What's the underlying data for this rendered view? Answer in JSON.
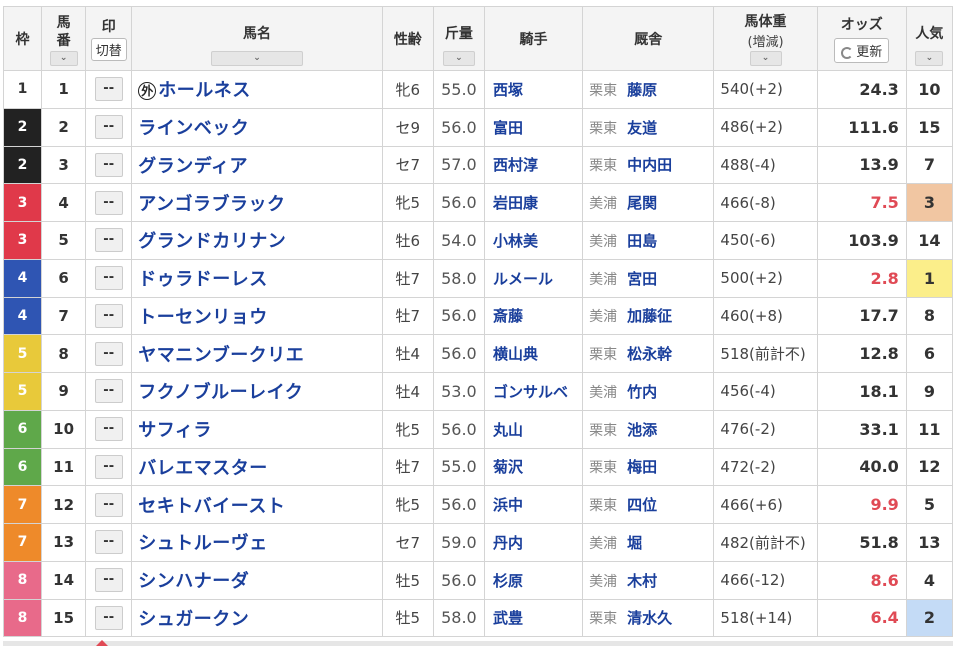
{
  "header": {
    "waku": "枠",
    "umaban": "馬\n番",
    "umaban_1": "馬",
    "umaban_2": "番",
    "shirushi": "印",
    "kirikae": "切替",
    "bamei": "馬名",
    "seirei": "性齢",
    "kinryo": "斤量",
    "kishu": "騎手",
    "kyusha": "厩舎",
    "bataiju": "馬体重",
    "zogen": "(増減)",
    "odds": "オッズ",
    "koshin": "更新",
    "ninki": "人気",
    "sort_icon": "chevron-down-icon",
    "sort_glyph": "⌄"
  },
  "colors": {
    "waku": {
      "1": "#ffffff",
      "2": "#222222",
      "3": "#e0394a",
      "4": "#2f55b3",
      "5": "#e8c93a",
      "6": "#5fa84a",
      "7": "#ee8a2a",
      "8": "#e86a8a"
    },
    "link": "#1a3f9c",
    "hot_odds": "#e04a55"
  },
  "mark_label": "--",
  "foreign_badge": "外",
  "rows": [
    {
      "waku": "1",
      "umaban": "1",
      "name": "ホールネス",
      "foreign": true,
      "sexage": "牝6",
      "weight": "55.0",
      "jockey": "西塚",
      "area": "栗東",
      "trainer": "藤原",
      "bw": "540(+2)",
      "odds": "24.3",
      "hot": false,
      "pop": "10",
      "popcls": ""
    },
    {
      "waku": "2",
      "umaban": "2",
      "name": "ラインベック",
      "foreign": false,
      "sexage": "セ9",
      "weight": "56.0",
      "jockey": "富田",
      "area": "栗東",
      "trainer": "友道",
      "bw": "486(+2)",
      "odds": "111.6",
      "hot": false,
      "pop": "15",
      "popcls": ""
    },
    {
      "waku": "2",
      "umaban": "3",
      "name": "グランディア",
      "foreign": false,
      "sexage": "セ7",
      "weight": "57.0",
      "jockey": "西村淳",
      "area": "栗東",
      "trainer": "中内田",
      "bw": "488(-4)",
      "odds": "13.9",
      "hot": false,
      "pop": "7",
      "popcls": ""
    },
    {
      "waku": "3",
      "umaban": "4",
      "name": "アンゴラブラック",
      "foreign": false,
      "sexage": "牝5",
      "weight": "56.0",
      "jockey": "岩田康",
      "area": "美浦",
      "trainer": "尾関",
      "bw": "466(-8)",
      "odds": "7.5",
      "hot": true,
      "pop": "3",
      "popcls": "p3"
    },
    {
      "waku": "3",
      "umaban": "5",
      "name": "グランドカリナン",
      "foreign": false,
      "sexage": "牡6",
      "weight": "54.0",
      "jockey": "小林美",
      "area": "美浦",
      "trainer": "田島",
      "bw": "450(-6)",
      "odds": "103.9",
      "hot": false,
      "pop": "14",
      "popcls": ""
    },
    {
      "waku": "4",
      "umaban": "6",
      "name": "ドゥラドーレス",
      "foreign": false,
      "sexage": "牡7",
      "weight": "58.0",
      "jockey": "ルメール",
      "area": "美浦",
      "trainer": "宮田",
      "bw": "500(+2)",
      "odds": "2.8",
      "hot": true,
      "pop": "1",
      "popcls": "p1"
    },
    {
      "waku": "4",
      "umaban": "7",
      "name": "トーセンリョウ",
      "foreign": false,
      "sexage": "牡7",
      "weight": "56.0",
      "jockey": "斎藤",
      "area": "美浦",
      "trainer": "加藤征",
      "bw": "460(+8)",
      "odds": "17.7",
      "hot": false,
      "pop": "8",
      "popcls": ""
    },
    {
      "waku": "5",
      "umaban": "8",
      "name": "ヤマニンブークリエ",
      "foreign": false,
      "sexage": "牡4",
      "weight": "56.0",
      "jockey": "横山典",
      "area": "栗東",
      "trainer": "松永幹",
      "bw": "518(前計不)",
      "odds": "12.8",
      "hot": false,
      "pop": "6",
      "popcls": ""
    },
    {
      "waku": "5",
      "umaban": "9",
      "name": "フクノブルーレイク",
      "foreign": false,
      "sexage": "牡4",
      "weight": "53.0",
      "jockey": "ゴンサルベ",
      "area": "美浦",
      "trainer": "竹内",
      "bw": "456(-4)",
      "odds": "18.1",
      "hot": false,
      "pop": "9",
      "popcls": ""
    },
    {
      "waku": "6",
      "umaban": "10",
      "name": "サフィラ",
      "foreign": false,
      "sexage": "牝5",
      "weight": "56.0",
      "jockey": "丸山",
      "area": "栗東",
      "trainer": "池添",
      "bw": "476(-2)",
      "odds": "33.1",
      "hot": false,
      "pop": "11",
      "popcls": ""
    },
    {
      "waku": "6",
      "umaban": "11",
      "name": "バレエマスター",
      "foreign": false,
      "sexage": "牡7",
      "weight": "55.0",
      "jockey": "菊沢",
      "area": "栗東",
      "trainer": "梅田",
      "bw": "472(-2)",
      "odds": "40.0",
      "hot": false,
      "pop": "12",
      "popcls": ""
    },
    {
      "waku": "7",
      "umaban": "12",
      "name": "セキトバイースト",
      "foreign": false,
      "sexage": "牝5",
      "weight": "56.0",
      "jockey": "浜中",
      "area": "栗東",
      "trainer": "四位",
      "bw": "466(+6)",
      "odds": "9.9",
      "hot": true,
      "pop": "5",
      "popcls": ""
    },
    {
      "waku": "7",
      "umaban": "13",
      "name": "シュトルーヴェ",
      "foreign": false,
      "sexage": "セ7",
      "weight": "59.0",
      "jockey": "丹内",
      "area": "美浦",
      "trainer": "堀",
      "bw": "482(前計不)",
      "odds": "51.8",
      "hot": false,
      "pop": "13",
      "popcls": ""
    },
    {
      "waku": "8",
      "umaban": "14",
      "name": "シンハナーダ",
      "foreign": false,
      "sexage": "牡5",
      "weight": "56.0",
      "jockey": "杉原",
      "area": "美浦",
      "trainer": "木村",
      "bw": "466(-12)",
      "odds": "8.6",
      "hot": true,
      "pop": "4",
      "popcls": ""
    },
    {
      "waku": "8",
      "umaban": "15",
      "name": "シュガークン",
      "foreign": false,
      "sexage": "牡5",
      "weight": "58.0",
      "jockey": "武豊",
      "area": "栗東",
      "trainer": "清水久",
      "bw": "518(+14)",
      "odds": "6.4",
      "hot": true,
      "pop": "2",
      "popcls": "p2"
    }
  ]
}
